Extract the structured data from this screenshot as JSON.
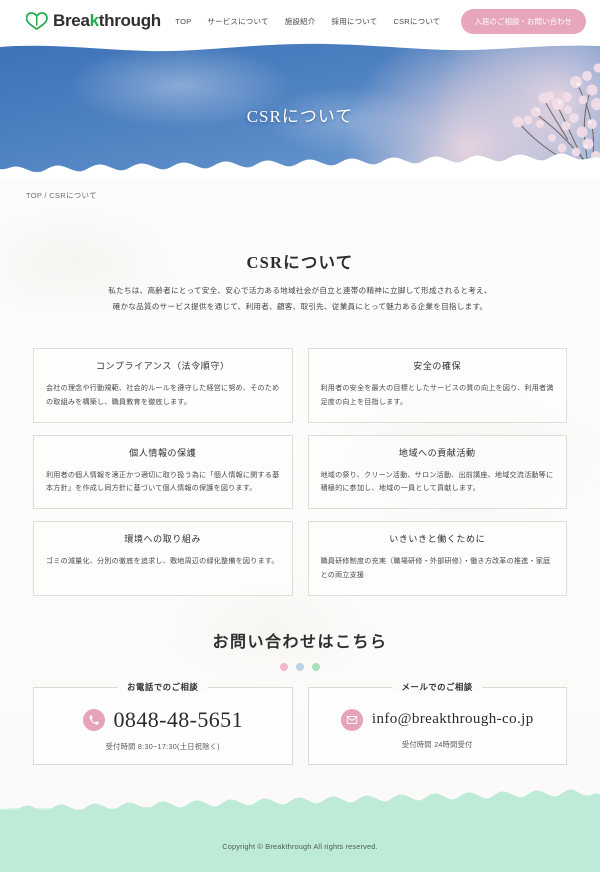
{
  "header": {
    "logo_text_before": "Brea",
    "logo_text_k": "k",
    "logo_text_after": "through",
    "logo_icon": "heart-icon",
    "nav": [
      {
        "label": "TOP"
      },
      {
        "label": "サービスについて"
      },
      {
        "label": "施設紹介"
      },
      {
        "label": "採用について"
      },
      {
        "label": "CSRについて"
      }
    ],
    "cta_label": "入居のご相談・お問い合わせ",
    "cta_color": "#e7a6b9"
  },
  "hero": {
    "title": "CSRについて",
    "sky_color": "#4c7fc0",
    "blossom_color": "#ecd4de"
  },
  "breadcrumb": {
    "home": "TOP",
    "separator": " / ",
    "current": "CSRについて"
  },
  "main": {
    "section_title": "CSRについて",
    "lead_line1": "私たちは、高齢者にとって安全、安心で活力ある地域社会が自立と連帯の精神に立脚して形成されると考え、",
    "lead_line2": "確かな品質のサービス提供を通じて、利用者、顧客、取引先、従業員にとって魅力ある企業を目指します。",
    "cards": [
      {
        "title": "コンプライアンス（法令順守）",
        "body": "会社の理念や行動規範、社会的ルールを遵守した経営に努め、そのための取組みを構築し、職員教育を徹底します。"
      },
      {
        "title": "安全の確保",
        "body": "利用者の安全を最大の目標としたサービスの質の向上を図り、利用者満足度の向上を目指します。"
      },
      {
        "title": "個人情報の保護",
        "body": "利用者の個人情報を適正かつ適切に取り扱う為に「個人情報に関する基本方針」を作成し同方針に基づいて個人情報の保護を図ります。"
      },
      {
        "title": "地域への貢献活動",
        "body": "地域の祭り、クリーン活動、サロン活動、出前講座、地域交流活動等に積極的に参加し、地域の一員として貢献します。"
      },
      {
        "title": "環境への取り組み",
        "body": "ゴミの減量化、分別の徹底を追求し、敷地周辺の緑化整備を図ります。"
      },
      {
        "title": "いきいきと働くために",
        "body": "職員研修制度の充実（職場研修・外部研修）・働き方改革の推進・家庭との両立支援"
      }
    ]
  },
  "contact": {
    "title": "お問い合わせはこちら",
    "dots": [
      "#f0b8c8",
      "#b9d4e8",
      "#a9dfb9"
    ],
    "phone": {
      "heading": "お電話でのご相談",
      "icon": "phone-icon",
      "value": "0848-48-5651",
      "note": "受付時間 8:30~17:30(土日祝除く)"
    },
    "mail": {
      "heading": "メールでのご相談",
      "icon": "mail-icon",
      "value": "info@breakthrough-co.jp",
      "note": "受付時間 24時間受付"
    }
  },
  "footer": {
    "copyright": "Copyright © Breakthrough All rights reserved.",
    "bg_color": "#bdebd8"
  }
}
